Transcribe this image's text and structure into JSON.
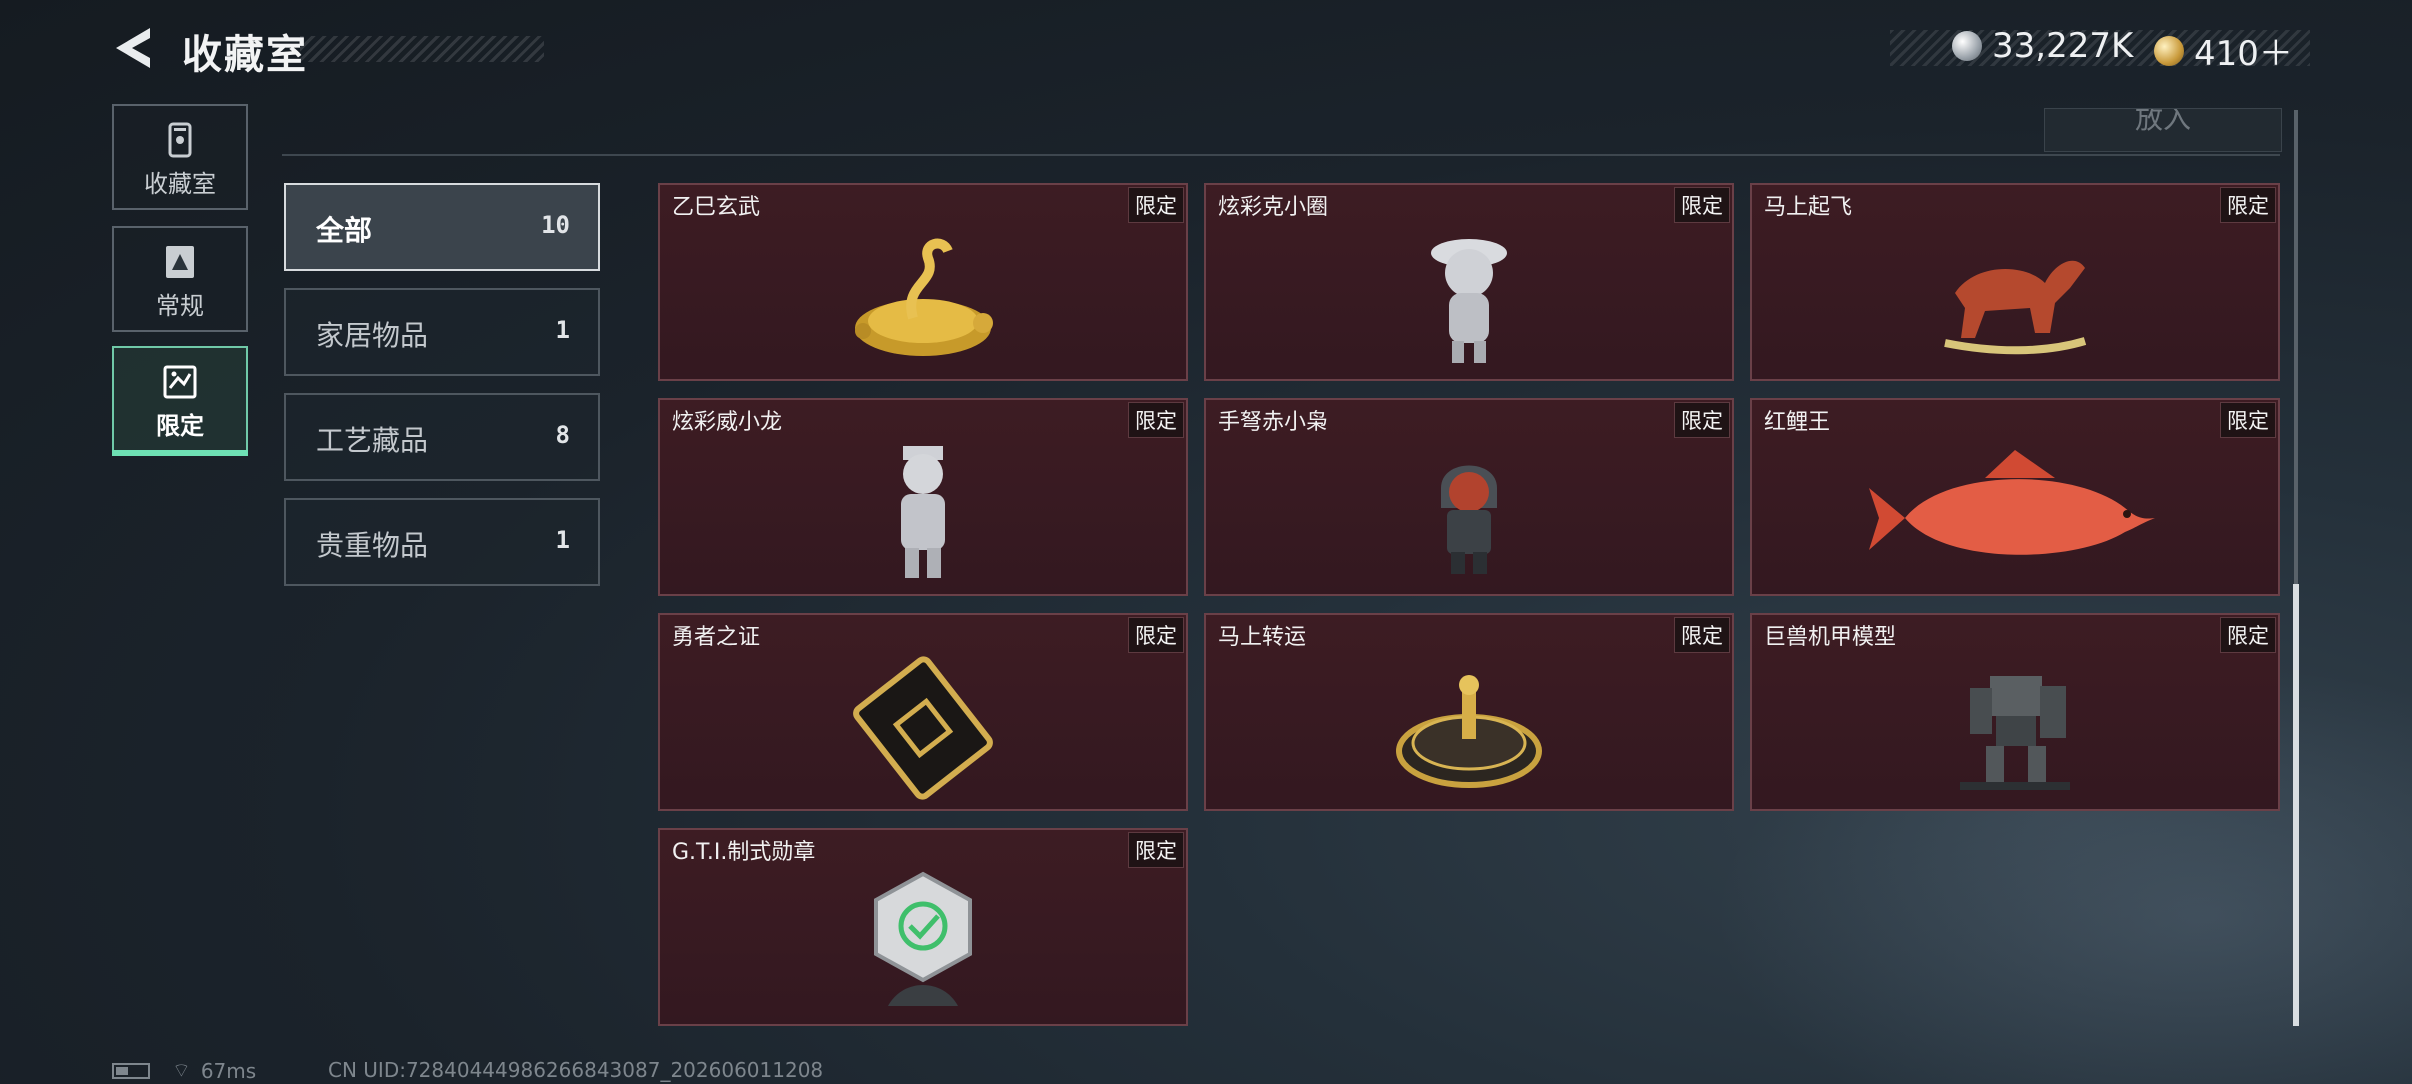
{
  "header": {
    "title": "收藏室",
    "currency": [
      {
        "icon": "silver-coin-icon",
        "value": "33,227K"
      },
      {
        "icon": "gold-coin-icon",
        "value": "410＋"
      }
    ]
  },
  "nav": {
    "items": [
      {
        "label": "收藏室",
        "icon": "collection-room-icon"
      },
      {
        "label": "常规",
        "icon": "regular-icon"
      },
      {
        "label": "限定",
        "icon": "limited-icon",
        "active": true
      }
    ]
  },
  "content": {
    "put_button": "放入"
  },
  "categories": [
    {
      "label": "全部",
      "count": "10",
      "selected": true
    },
    {
      "label": "家居物品",
      "count": "1"
    },
    {
      "label": "工艺藏品",
      "count": "8"
    },
    {
      "label": "贵重物品",
      "count": "1"
    }
  ],
  "items": [
    {
      "name": "乙巳玄武",
      "tag": "限定",
      "art": "golden-turtle-snake-icon"
    },
    {
      "name": "炫彩克小圈",
      "tag": "限定",
      "art": "silver-figurine-icon"
    },
    {
      "name": "马上起飞",
      "tag": "限定",
      "art": "red-horse-statue-icon"
    },
    {
      "name": "炫彩威小龙",
      "tag": "限定",
      "art": "silver-dragon-figurine-icon"
    },
    {
      "name": "手弩赤小枭",
      "tag": "限定",
      "art": "hooded-figurine-icon"
    },
    {
      "name": "红鲤王",
      "tag": "限定",
      "art": "red-carp-icon"
    },
    {
      "name": "勇者之证",
      "tag": "限定",
      "art": "black-gold-card-icon"
    },
    {
      "name": "马上转运",
      "tag": "限定",
      "art": "golden-dial-icon"
    },
    {
      "name": "巨兽机甲模型",
      "tag": "限定",
      "art": "mech-model-icon"
    },
    {
      "name": "G.T.I.制式勋章",
      "tag": "限定",
      "art": "silver-medal-icon"
    }
  ],
  "footer": {
    "ping": "67ms",
    "uid": "CN UID:7284044498626​6843087_202606011208"
  },
  "colors": {
    "accent_green": "#6ee0b4",
    "card_bg": "#3d1c23",
    "card_border": "#6a4048"
  }
}
